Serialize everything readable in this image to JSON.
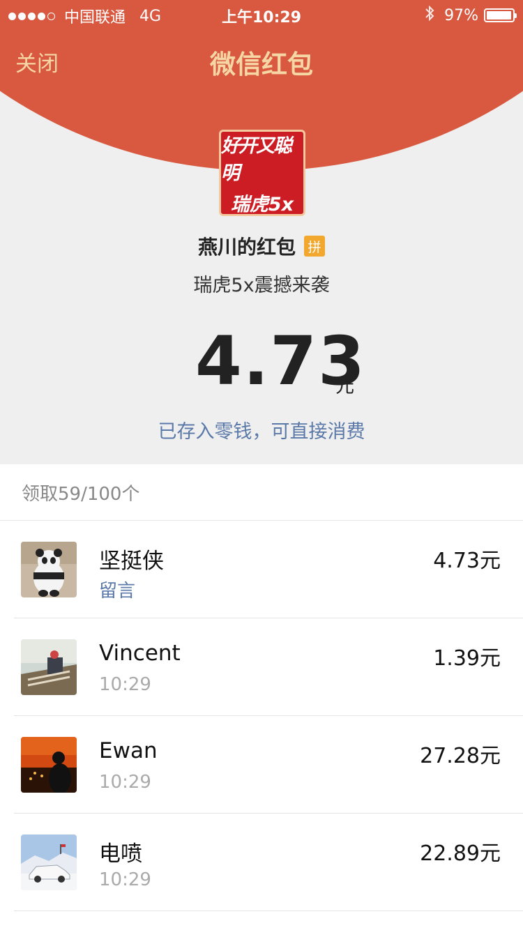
{
  "status_bar": {
    "carrier": "中国联通",
    "network": "4G",
    "time": "上午10:29",
    "battery": "97%",
    "battery_level": 0.97
  },
  "nav": {
    "close": "关闭",
    "title": "微信红包"
  },
  "logo": {
    "line1": "好开又聪明",
    "line2": "瑞虎5x"
  },
  "packet": {
    "sender": "燕川的红包",
    "badge": "拼",
    "wish": "瑞虎5x震撼来袭",
    "amount": "4.73",
    "unit": "元",
    "saved_note": "已存入零钱，可直接消费"
  },
  "list": {
    "count": "领取59/100个",
    "rows": [
      {
        "name": "坚挺侠",
        "sub": "留言",
        "amount": "4.73元"
      },
      {
        "name": "Vincent",
        "sub": "10:29",
        "amount": "1.39元"
      },
      {
        "name": "Ewan",
        "sub": "10:29",
        "amount": "27.28元"
      },
      {
        "name": "电喷",
        "sub": "10:29",
        "amount": "22.89元"
      }
    ]
  },
  "colors": {
    "header_red": "#d85940",
    "gold_text": "#f6d6a4",
    "link_blue": "#5b79a8"
  }
}
